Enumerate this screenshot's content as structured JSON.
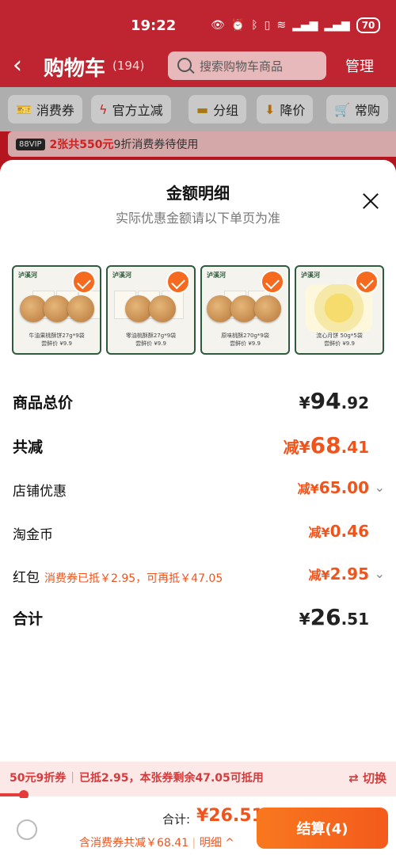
{
  "status": {
    "time": "19:22",
    "battery": "70"
  },
  "header": {
    "title": "购物车",
    "count": "(194)",
    "search_placeholder": "搜索购物车商品",
    "manage": "管理"
  },
  "filters": [
    {
      "label": "消费券",
      "icon": "coupon-icon"
    },
    {
      "label": "官方立减",
      "icon": "lightning-icon"
    },
    {
      "label": "分组",
      "icon": "folder-icon"
    },
    {
      "label": "降价",
      "icon": "price-drop-icon"
    },
    {
      "label": "常购",
      "icon": "cart-icon"
    }
  ],
  "vip_banner": {
    "badge": "88VIP",
    "highlight": "2张共550元",
    "rest": "9折消费券待使用"
  },
  "sheet": {
    "title": "金额明细",
    "subtitle": "实际优惠金额请以下单页为准",
    "thumbnails": [
      {
        "brand": "泸溪河",
        "caption": "牛油果桃酥饼27g*9袋\n尝鲜价 ¥9.9"
      },
      {
        "brand": "泸溪河",
        "caption": "零油桃酥酥27g*9袋\n尝鲜价 ¥9.9"
      },
      {
        "brand": "泸溪河",
        "caption": "原味桃酥270g*9袋\n尝鲜价 ¥9.9"
      },
      {
        "brand": "泸溪河",
        "caption": "流心月饼 50g*5袋\n尝鲜价 ¥9.9"
      }
    ],
    "rows": {
      "total_goods": {
        "label": "商品总价",
        "currency": "¥",
        "int": "94",
        "dec": ".92"
      },
      "total_discount": {
        "label": "共减",
        "prefix": "减¥",
        "int": "68",
        "dec": ".41"
      },
      "shop_discount": {
        "label": "店铺优惠",
        "prefix": "减¥",
        "value": "65.00"
      },
      "coins": {
        "label": "淘金币",
        "prefix": "减¥",
        "value": "0.46"
      },
      "red_packet": {
        "label": "红包",
        "note": "消费券已抵￥2.95，可再抵￥47.05",
        "prefix": "减¥",
        "value": "2.95"
      },
      "sum": {
        "label": "合计",
        "currency": "¥",
        "int": "26",
        "dec": ".51"
      }
    }
  },
  "coupon_bar": {
    "name": "50元9折券",
    "status": "已抵2.95，本张券剩余47.05可抵用",
    "switch": "⇄ 切换",
    "progress": 0.059
  },
  "footer": {
    "total_label": "合计:",
    "total_value": "¥26.51",
    "savings": "含消费券共减￥68.41",
    "detail": "明细 ^",
    "checkout": "结算(4)"
  }
}
